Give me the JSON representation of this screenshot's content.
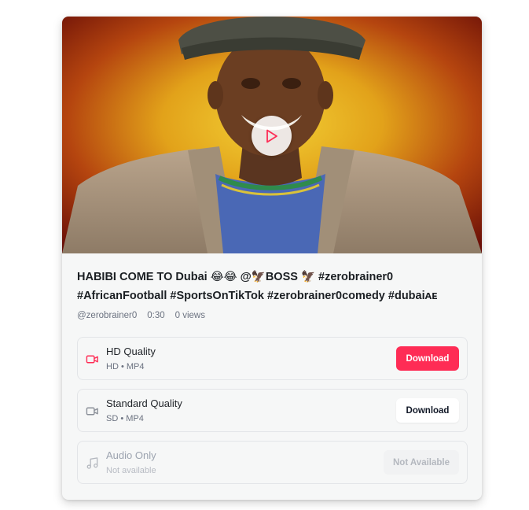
{
  "video": {
    "title": "HABIBI COME TO Dubai 😂😂 @🦅BOSS 🦅 #zerobrainer0 #AfricanFootball #SportsOnTikTok #zerobrainer0comedy #dubaiᴀᴇ",
    "author": "@zerobrainer0",
    "duration": "0:30",
    "views": "0 views"
  },
  "options": [
    {
      "name": "HD Quality",
      "sub": "HD • MP4",
      "button": "Download",
      "icon": "video-camera-icon",
      "state": "primary"
    },
    {
      "name": "Standard Quality",
      "sub": "SD • MP4",
      "button": "Download",
      "icon": "video-camera-icon",
      "state": "secondary"
    },
    {
      "name": "Audio Only",
      "sub": "Not available",
      "button": "Not Available",
      "icon": "music-note-icon",
      "state": "disabled"
    }
  ],
  "colors": {
    "accent": "#fe2c55",
    "card_bg": "#f6f7f7",
    "text": "#1b1f23",
    "muted": "#6b7280"
  }
}
